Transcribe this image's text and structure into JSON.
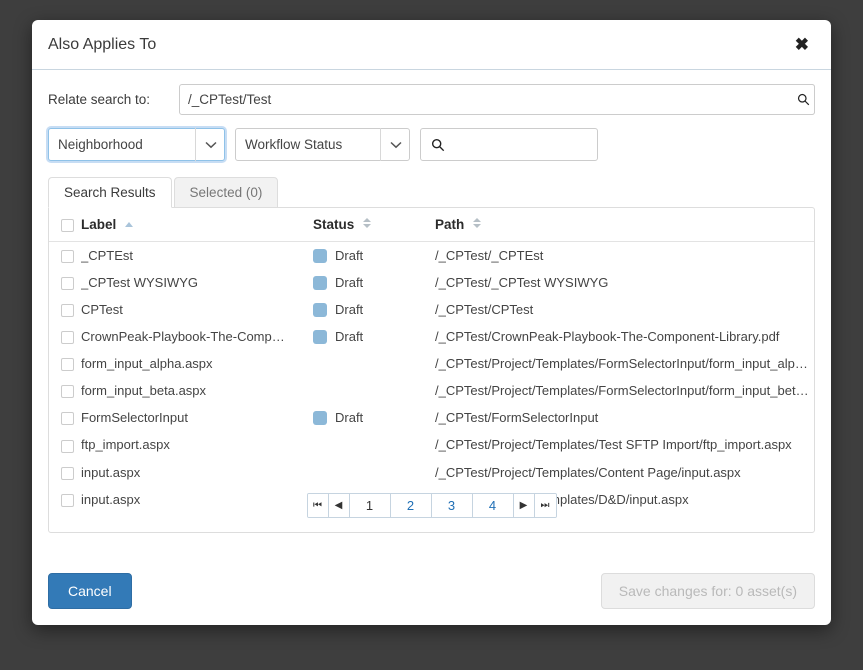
{
  "dialog": {
    "title": "Also Applies To",
    "close_icon": "close-icon"
  },
  "relate": {
    "label": "Relate search to:",
    "value": "/_CPTest/Test",
    "placeholder": "",
    "search_icon": "search-icon"
  },
  "filters": {
    "type_select": {
      "value": "Neighborhood",
      "caret_icon": "chevron-down-icon"
    },
    "status_select": {
      "value": "Workflow Status",
      "caret_icon": "chevron-down-icon"
    },
    "keyword": {
      "value": "",
      "placeholder": "",
      "search_icon": "search-icon"
    }
  },
  "tabs": [
    {
      "label": "Search Results",
      "active": true
    },
    {
      "label": "Selected (0)",
      "active": false
    }
  ],
  "table": {
    "columns": [
      {
        "key": "checkbox",
        "label": "",
        "sort": "none"
      },
      {
        "key": "label",
        "label": "Label",
        "sort": "asc"
      },
      {
        "key": "status",
        "label": "Status",
        "sort": "both"
      },
      {
        "key": "path",
        "label": "Path",
        "sort": "both"
      }
    ],
    "rows": [
      {
        "checked": false,
        "label": "_CPTEst",
        "status": "Draft",
        "path": "/_CPTest/_CPTEst"
      },
      {
        "checked": false,
        "label": "_CPTest WYSIWYG",
        "status": "Draft",
        "path": "/_CPTest/_CPTest WYSIWYG"
      },
      {
        "checked": false,
        "label": "CPTest",
        "status": "Draft",
        "path": "/_CPTest/CPTest"
      },
      {
        "checked": false,
        "label": "CrownPeak-Playbook-The-Comp…",
        "status": "Draft",
        "path": "/_CPTest/CrownPeak-Playbook-The-Component-Library.pdf"
      },
      {
        "checked": false,
        "label": "form_input_alpha.aspx",
        "status": "",
        "path": "/_CPTest/Project/Templates/FormSelectorInput/form_input_alph…"
      },
      {
        "checked": false,
        "label": "form_input_beta.aspx",
        "status": "",
        "path": "/_CPTest/Project/Templates/FormSelectorInput/form_input_beta.…"
      },
      {
        "checked": false,
        "label": "FormSelectorInput",
        "status": "Draft",
        "path": "/_CPTest/FormSelectorInput"
      },
      {
        "checked": false,
        "label": "ftp_import.aspx",
        "status": "",
        "path": "/_CPTest/Project/Templates/Test SFTP Import/ftp_import.aspx"
      },
      {
        "checked": false,
        "label": "input.aspx",
        "status": "",
        "path": "/_CPTest/Project/Templates/Content Page/input.aspx"
      },
      {
        "checked": false,
        "label": "input.aspx",
        "status": "",
        "path": "/_CPTest/Project/Templates/D&D/input.aspx"
      }
    ]
  },
  "pagination": {
    "first": {
      "label": "⏮",
      "enabled": false
    },
    "prev": {
      "label": "◀",
      "enabled": false
    },
    "pages": [
      {
        "label": "1",
        "current": true
      },
      {
        "label": "2",
        "current": false
      },
      {
        "label": "3",
        "current": false
      },
      {
        "label": "4",
        "current": false
      }
    ],
    "next": {
      "label": "▶",
      "enabled": true
    },
    "last": {
      "label": "⏭",
      "enabled": true
    }
  },
  "footer": {
    "cancel_label": "Cancel",
    "save_label": "Save changes for: 0 asset(s)",
    "save_enabled": false
  },
  "colors": {
    "primary": "#337ab7",
    "status_draft": "#8cb8d8",
    "link": "#1f6fb5",
    "backdrop": "#3e3e3e"
  }
}
